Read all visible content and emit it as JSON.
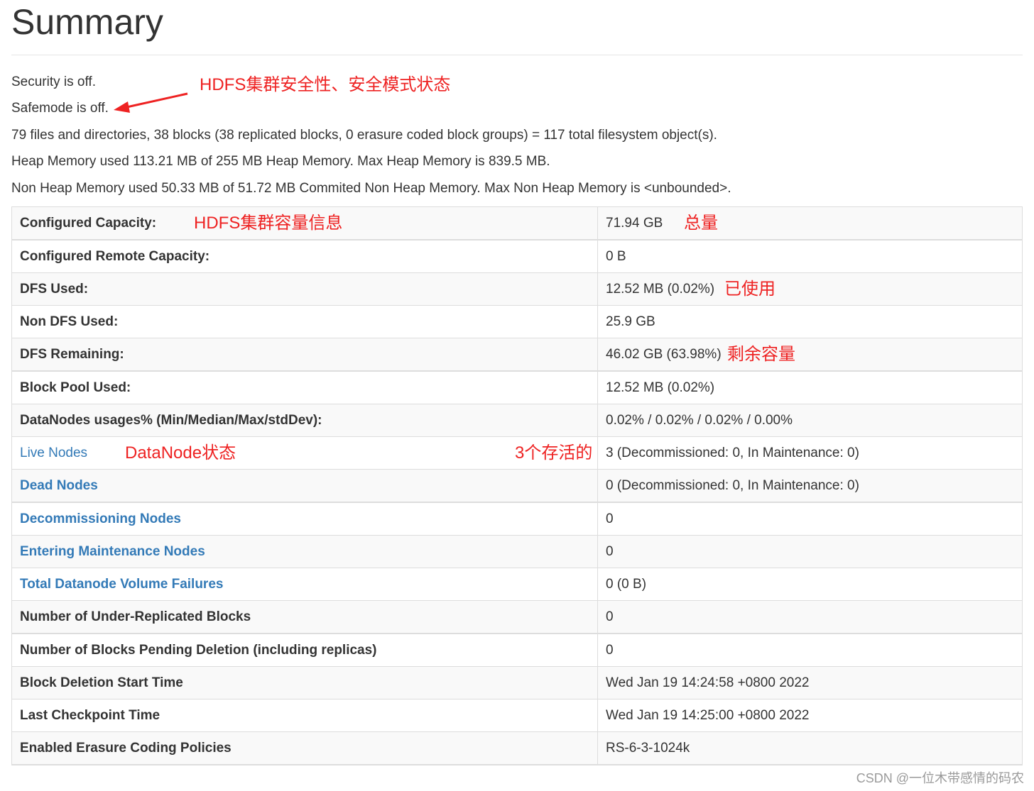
{
  "page": {
    "title": "Summary"
  },
  "info": {
    "security": "Security is off.",
    "safemode": "Safemode is off.",
    "objects": "79 files and directories, 38 blocks (38 replicated blocks, 0 erasure coded block groups) = 117 total filesystem object(s).",
    "heap": "Heap Memory used 113.21 MB of 255 MB Heap Memory. Max Heap Memory is 839.5 MB.",
    "non_heap": "Non Heap Memory used 50.33 MB of 51.72 MB Commited Non Heap Memory. Max Non Heap Memory is <unbounded>."
  },
  "annotations": {
    "security_safemode": "HDFS集群安全性、安全模式状态",
    "capacity_info": "HDFS集群容量信息",
    "total": "总量",
    "used": "已使用",
    "remaining": "剩余容量",
    "datanode_status": "DataNode状态",
    "alive_count": "3个存活的",
    "color": "#ee2222"
  },
  "rows": [
    {
      "label": "Configured Capacity:",
      "value": "71.94 GB"
    },
    {
      "label": "Configured Remote Capacity:",
      "value": "0 B"
    },
    {
      "label": "DFS Used:",
      "value": "12.52 MB (0.02%)"
    },
    {
      "label": "Non DFS Used:",
      "value": "25.9 GB"
    },
    {
      "label": "DFS Remaining:",
      "value": "46.02 GB (63.98%)"
    },
    {
      "label": "Block Pool Used:",
      "value": "12.52 MB (0.02%)"
    },
    {
      "label": "DataNodes usages% (Min/Median/Max/stdDev):",
      "value": "0.02% / 0.02% / 0.02% / 0.00%"
    },
    {
      "label": "Live Nodes",
      "value": "3 (Decommissioned: 0, In Maintenance: 0)"
    },
    {
      "label": "Dead Nodes",
      "value": "0 (Decommissioned: 0, In Maintenance: 0)"
    },
    {
      "label": "Decommissioning Nodes",
      "value": "0"
    },
    {
      "label": "Entering Maintenance Nodes",
      "value": "0"
    },
    {
      "label": "Total Datanode Volume Failures",
      "value": "0 (0 B)"
    },
    {
      "label": "Number of Under-Replicated Blocks",
      "value": "0"
    },
    {
      "label": "Number of Blocks Pending Deletion (including replicas)",
      "value": "0"
    },
    {
      "label": "Block Deletion Start Time",
      "value": "Wed Jan 19 14:24:58 +0800 2022"
    },
    {
      "label": "Last Checkpoint Time",
      "value": "Wed Jan 19 14:25:00 +0800 2022"
    },
    {
      "label": "Enabled Erasure Coding Policies",
      "value": "RS-6-3-1024k"
    }
  ],
  "watermark": "CSDN @一位木带感情的码农",
  "colors": {
    "link": "#337ab7",
    "text": "#333333",
    "border": "#dddddd",
    "stripe": "#f9f9f9"
  }
}
